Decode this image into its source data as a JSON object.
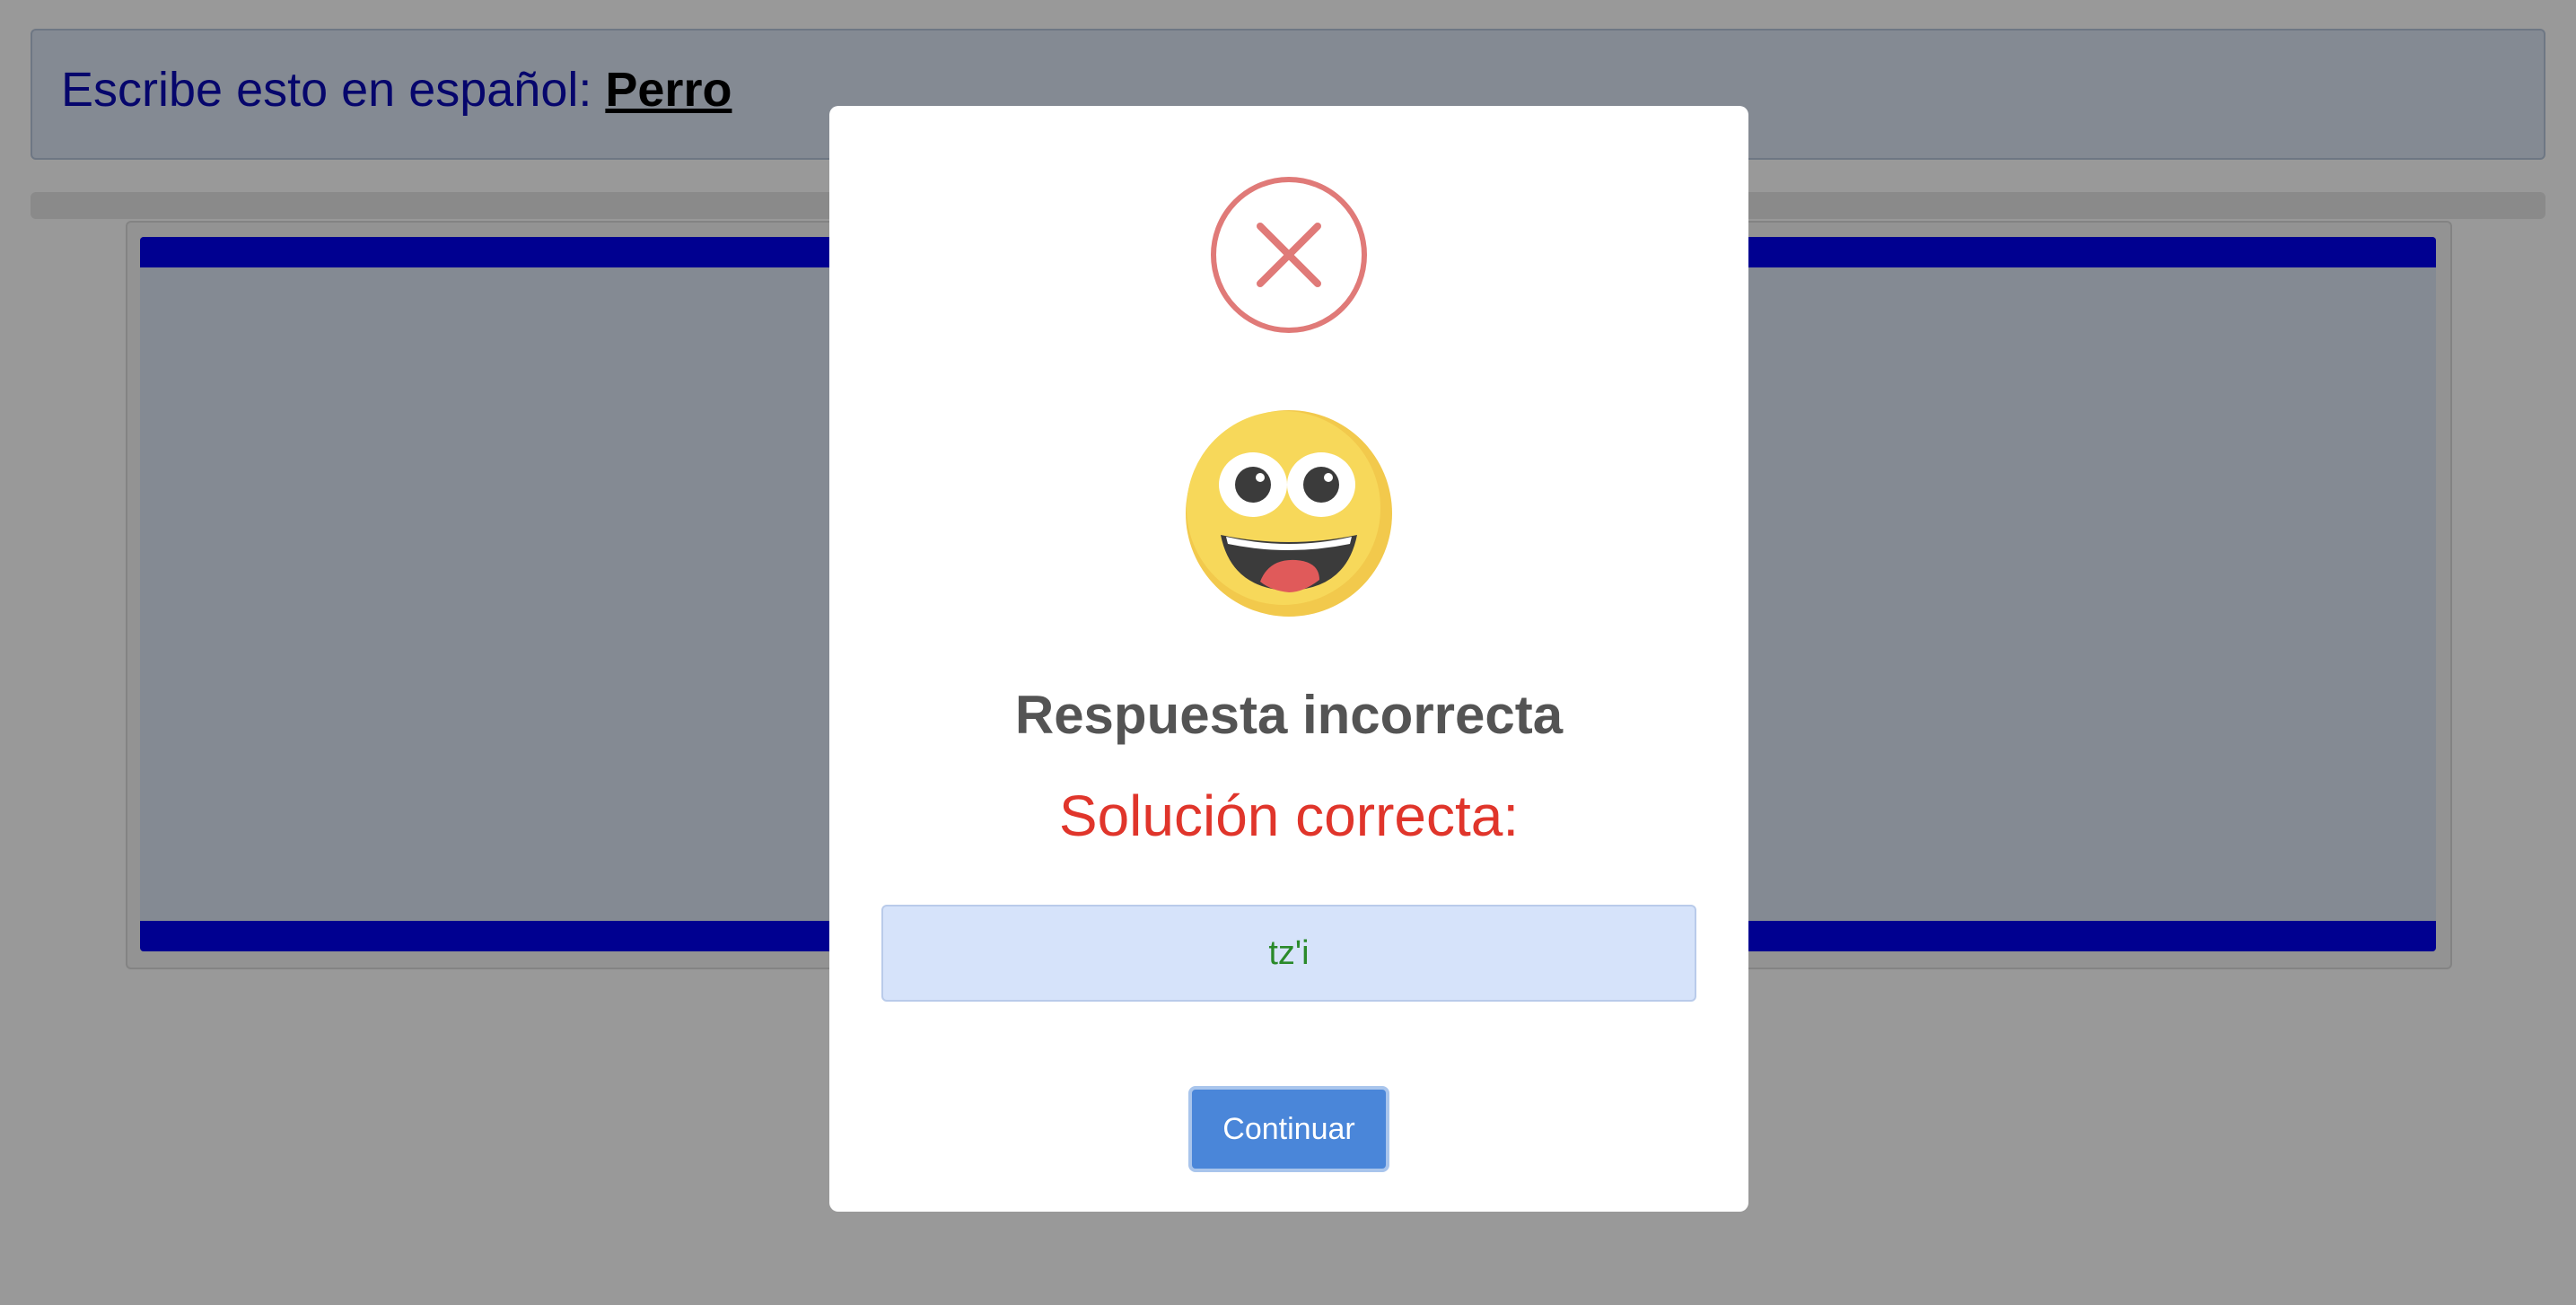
{
  "prompt": {
    "text": "Escribe esto en español: ",
    "word": "Perro"
  },
  "modal": {
    "status_icon": "x-circle-icon",
    "emoji_icon": "grinning-face-emoji-icon",
    "title": "Respuesta incorrecta",
    "subtitle": "Solución correcta:",
    "answer": "tz'i",
    "continue_label": "Continuar"
  },
  "colors": {
    "prompt_text": "#0a0ab4",
    "work_area_border": "#0000f0",
    "error_icon": "#e07a78",
    "subtitle": "#e0352b",
    "answer_text": "#2a8a2a",
    "answer_background": "#d6e3fa",
    "button": "#4a86d9"
  }
}
